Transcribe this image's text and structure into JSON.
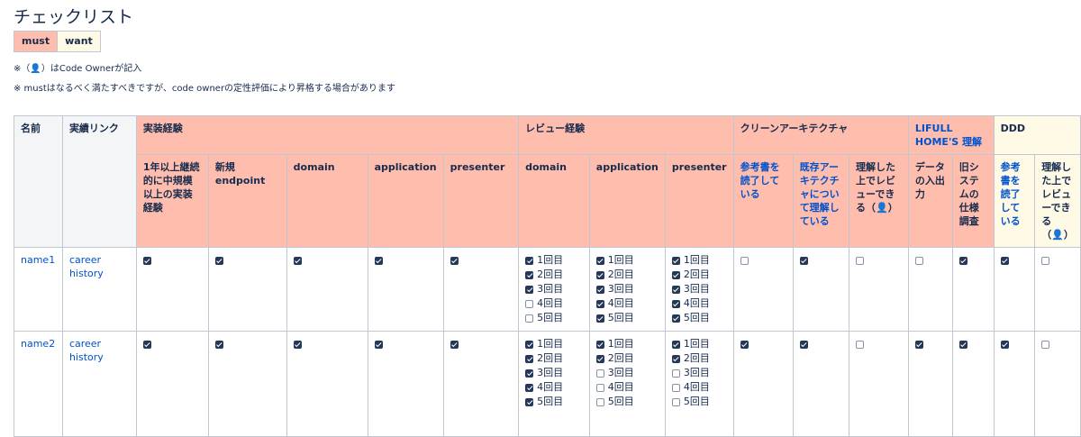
{
  "page_title": "チェックリスト",
  "legend": {
    "must": "must",
    "want": "want"
  },
  "notes": {
    "n1_prefix": "※（",
    "n1_icon": "person-icon",
    "n1_suffix": "）はCode Ownerが記入",
    "n2": "※ mustはなるべく満たすべきですが、code ownerの定性評価により昇格する場合があります"
  },
  "colors": {
    "must": "#ffbdad",
    "want": "#fffae6",
    "header_gray": "#f4f5f7",
    "link": "#0052cc",
    "checkbox_on": "#253858"
  },
  "table": {
    "h_name": "名前",
    "h_link": "実績リンク",
    "groups": {
      "impl": "実装経験",
      "review": "レビュー経験",
      "clean": "クリーンアーキテクチャ",
      "lifull": "LIFULL HOME'S 理解",
      "ddd": "DDD"
    },
    "sub": {
      "impl_1": "1年以上継続的に中規模以上の実装経験",
      "impl_2": "新規endpoint",
      "impl_3": "domain",
      "impl_4": "application",
      "impl_5": "presenter",
      "rev_1": "domain",
      "rev_2": "application",
      "rev_3": "presenter",
      "clean_1": "参考書を読了している",
      "clean_2": "既存アーキテクチャについて理解している",
      "clean_3a": "理解した上でレビューできる（",
      "clean_3b": "）",
      "lifull_1": "データの入出力",
      "lifull_2": "旧システムの仕様調査",
      "ddd_1": "参考書を読了している",
      "ddd_2a": "理解した上でレビューできる（",
      "ddd_2b": "）"
    },
    "rows": [
      {
        "name": "name1",
        "link": "career history",
        "impl": [
          true,
          true,
          true,
          true,
          true
        ],
        "review": [
          [
            {
              "l": "1回目",
              "c": true
            },
            {
              "l": "2回目",
              "c": true
            },
            {
              "l": "3回目",
              "c": true
            },
            {
              "l": "4回目",
              "c": false
            },
            {
              "l": "5回目",
              "c": false
            }
          ],
          [
            {
              "l": "1回目",
              "c": true
            },
            {
              "l": "2回目",
              "c": true
            },
            {
              "l": "3回目",
              "c": true
            },
            {
              "l": "4回目",
              "c": true
            },
            {
              "l": "5回目",
              "c": true
            }
          ],
          [
            {
              "l": "1回目",
              "c": true
            },
            {
              "l": "2回目",
              "c": true
            },
            {
              "l": "3回目",
              "c": true
            },
            {
              "l": "4回目",
              "c": true
            },
            {
              "l": "5回目",
              "c": true
            }
          ]
        ],
        "clean": [
          false,
          true,
          false
        ],
        "lifull": [
          false,
          true
        ],
        "ddd": [
          true,
          false
        ]
      },
      {
        "name": "name2",
        "link": "career history",
        "impl": [
          true,
          true,
          true,
          true,
          true
        ],
        "review": [
          [
            {
              "l": "1回目",
              "c": true
            },
            {
              "l": "2回目",
              "c": true
            },
            {
              "l": "3回目",
              "c": true
            },
            {
              "l": "4回目",
              "c": true
            },
            {
              "l": "5回目",
              "c": true
            }
          ],
          [
            {
              "l": "1回目",
              "c": true
            },
            {
              "l": "2回目",
              "c": true
            },
            {
              "l": "3回目",
              "c": false
            },
            {
              "l": "4回目",
              "c": false
            },
            {
              "l": "5回目",
              "c": false
            }
          ],
          [
            {
              "l": "1回目",
              "c": true
            },
            {
              "l": "2回目",
              "c": true
            },
            {
              "l": "3回目",
              "c": false
            },
            {
              "l": "4回目",
              "c": false
            },
            {
              "l": "5回目",
              "c": false
            }
          ]
        ],
        "clean": [
          true,
          true,
          false
        ],
        "lifull": [
          true,
          true
        ],
        "ddd": [
          true,
          false
        ]
      }
    ]
  }
}
